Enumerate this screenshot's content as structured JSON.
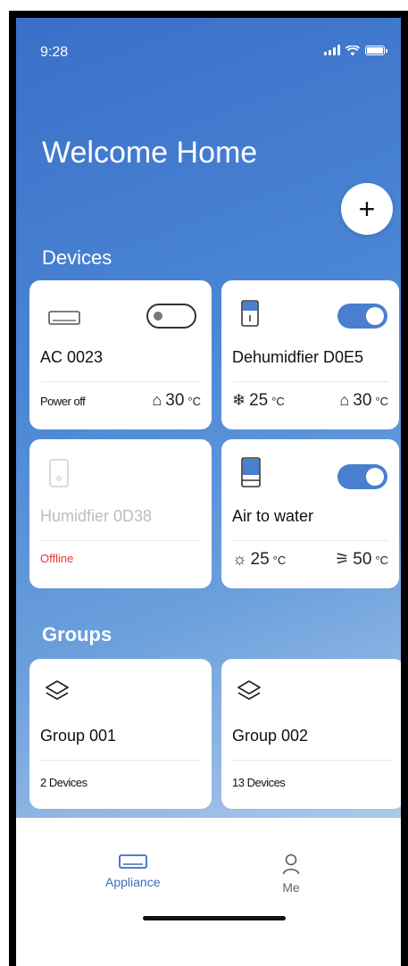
{
  "status": {
    "time": "9:28"
  },
  "header": {
    "title": "Welcome Home",
    "add_label": "+"
  },
  "sections": {
    "devices": "Devices",
    "groups": "Groups"
  },
  "devices": [
    {
      "name": "AC 0023",
      "status": "Power off",
      "toggle": "off",
      "indoor_temp": "30",
      "unit": "°C",
      "icon": "ac-icon"
    },
    {
      "name": "Dehumidfier D0E5",
      "toggle": "on",
      "set_temp": "25",
      "indoor_temp": "30",
      "unit": "°C",
      "icon": "dehumidifier-icon"
    },
    {
      "name": "Humidfier 0D38",
      "status": "Offline",
      "icon": "humidifier-icon"
    },
    {
      "name": "Air to water",
      "toggle": "on",
      "outdoor_temp": "25",
      "water_temp": "50",
      "unit": "°C",
      "icon": "air-to-water-icon"
    }
  ],
  "groups": [
    {
      "name": "Group 001",
      "count": "2 Devices",
      "icon": "layers-icon"
    },
    {
      "name": "Group 002",
      "count": "13 Devices",
      "icon": "layers-icon"
    }
  ],
  "tabs": [
    {
      "label": "Appliance",
      "icon": "appliance-icon",
      "active": true
    },
    {
      "label": "Me",
      "icon": "person-icon",
      "active": false
    }
  ],
  "colors": {
    "accent": "#4a7fcf",
    "offline": "#e53935"
  }
}
